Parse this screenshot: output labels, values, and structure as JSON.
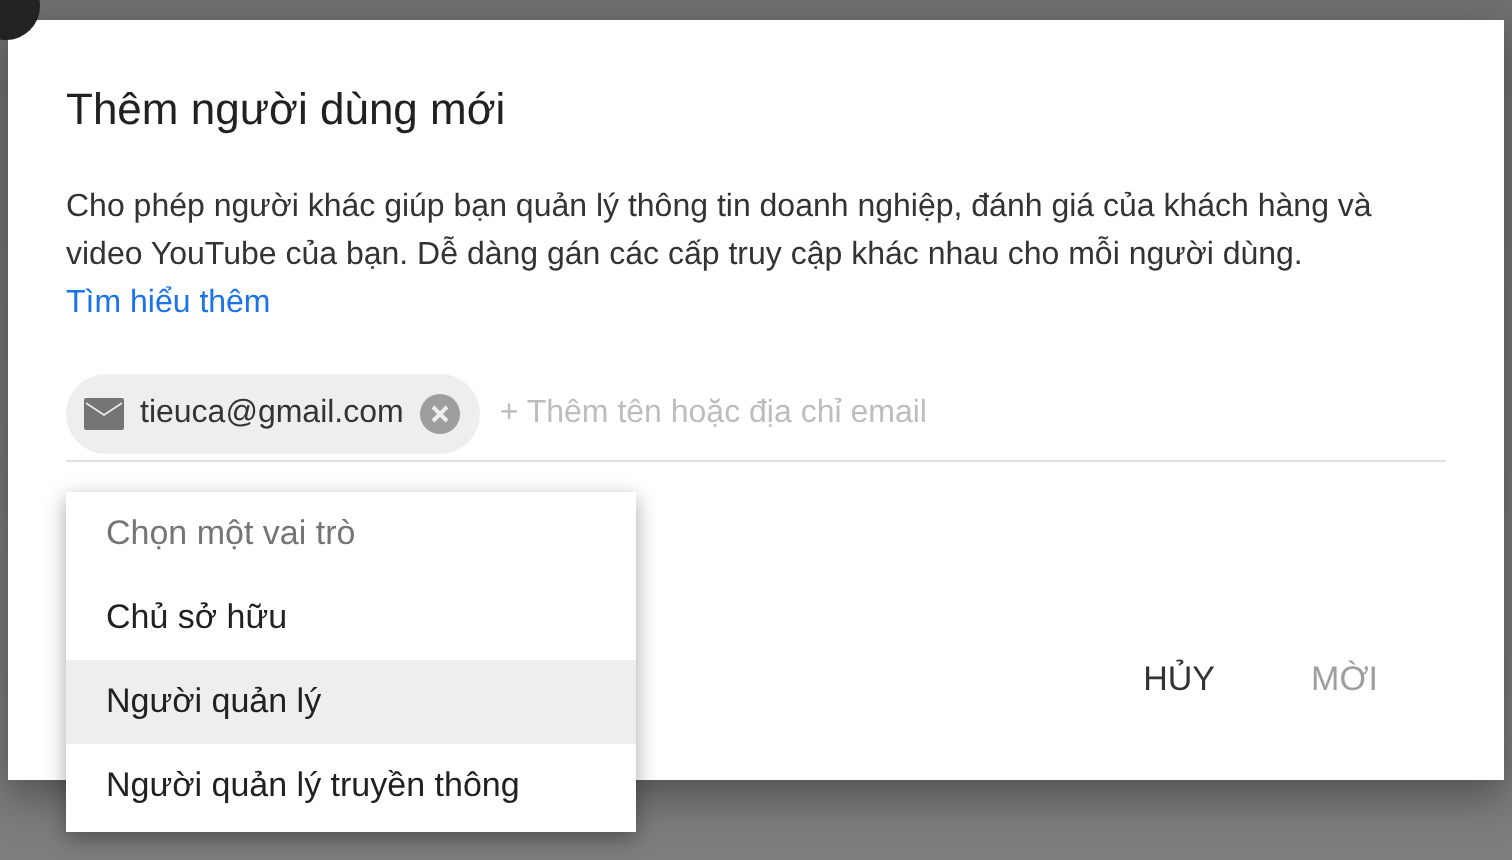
{
  "dialog": {
    "title": "Thêm người dùng mới",
    "description": "Cho phép người khác giúp bạn quản lý thông tin doanh nghiệp, đánh giá của khách hàng và video YouTube của bạn. Dễ dàng gán các cấp truy cập khác nhau cho mỗi người dùng.",
    "link": "Tìm hiểu thêm",
    "chips": [
      {
        "email": "tieuca@gmail.com"
      }
    ],
    "input": {
      "placeholder": "+ Thêm tên hoặc địa chỉ email"
    },
    "buttons": [
      {
        "label": "HỦY",
        "disabled": false
      },
      {
        "label": "MỜI",
        "disabled": true
      }
    ]
  },
  "role_menu": {
    "items": [
      {
        "label": "Chọn một vai trò",
        "kind": "header",
        "selected": false
      },
      {
        "label": "Chủ sở hữu",
        "kind": "option",
        "selected": false
      },
      {
        "label": "Người quản lý",
        "kind": "option",
        "selected": true
      },
      {
        "label": "Người quản lý truyền thông",
        "kind": "option",
        "selected": false
      }
    ]
  }
}
